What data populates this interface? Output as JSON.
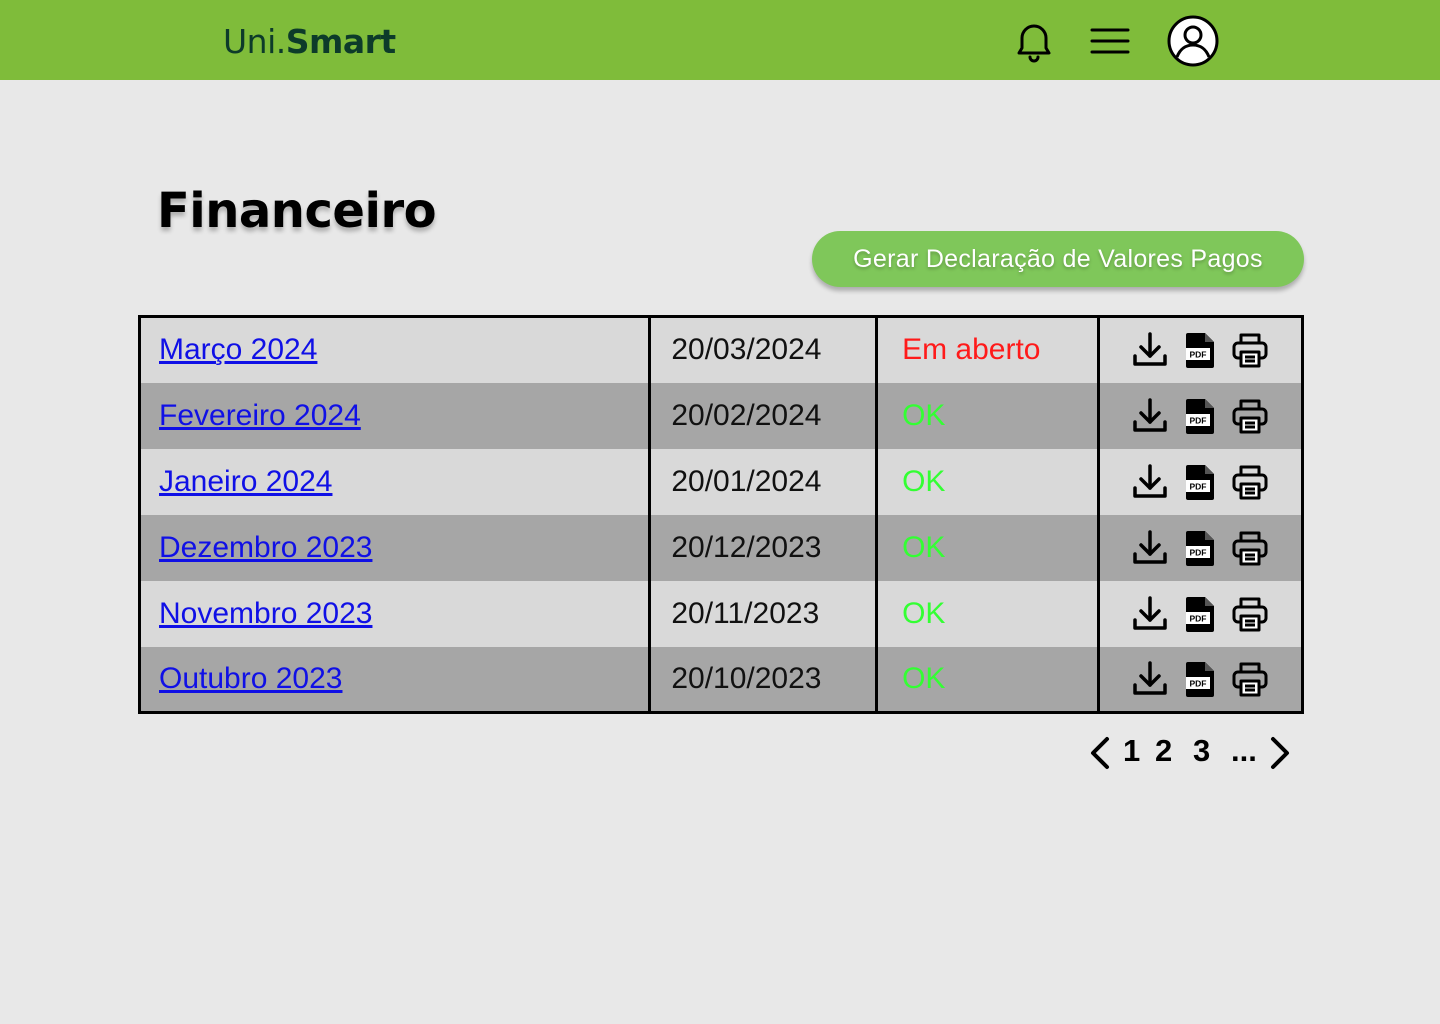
{
  "header": {
    "brand_part1": "Uni.",
    "brand_part2": "Smart",
    "bg_color": "#7fbc3a",
    "icons": [
      "bell-icon",
      "hamburger-menu-icon",
      "user-profile-icon"
    ]
  },
  "page": {
    "title": "Financeiro",
    "generate_button_label": "Gerar Declaração de Valores Pagos",
    "button_color": "#7fc75a"
  },
  "table": {
    "rows": [
      {
        "month": "Março 2024",
        "date": "20/03/2024",
        "status": "Em aberto",
        "status_type": "open"
      },
      {
        "month": "Fevereiro 2024",
        "date": "20/02/2024",
        "status": "OK",
        "status_type": "ok"
      },
      {
        "month": "Janeiro 2024",
        "date": "20/01/2024",
        "status": "OK",
        "status_type": "ok"
      },
      {
        "month": "Dezembro 2023",
        "date": "20/12/2023",
        "status": "OK",
        "status_type": "ok"
      },
      {
        "month": "Novembro 2023",
        "date": "20/11/2023",
        "status": "OK",
        "status_type": "ok"
      },
      {
        "month": "Outubro 2023",
        "date": "20/10/2023",
        "status": "OK",
        "status_type": "ok"
      }
    ],
    "action_icons": [
      "download-icon",
      "pdf-file-icon",
      "printer-icon"
    ],
    "row_colors": [
      "#d9d9d9",
      "#a6a6a6"
    ],
    "status_colors": {
      "open": "#ff1a1a",
      "ok": "#33ff33"
    },
    "link_color": "#1010e6"
  },
  "pagination": {
    "pages": [
      "1",
      "2",
      "3",
      "..."
    ],
    "prev_icon": "chevron-left-icon",
    "next_icon": "chevron-right-icon"
  }
}
